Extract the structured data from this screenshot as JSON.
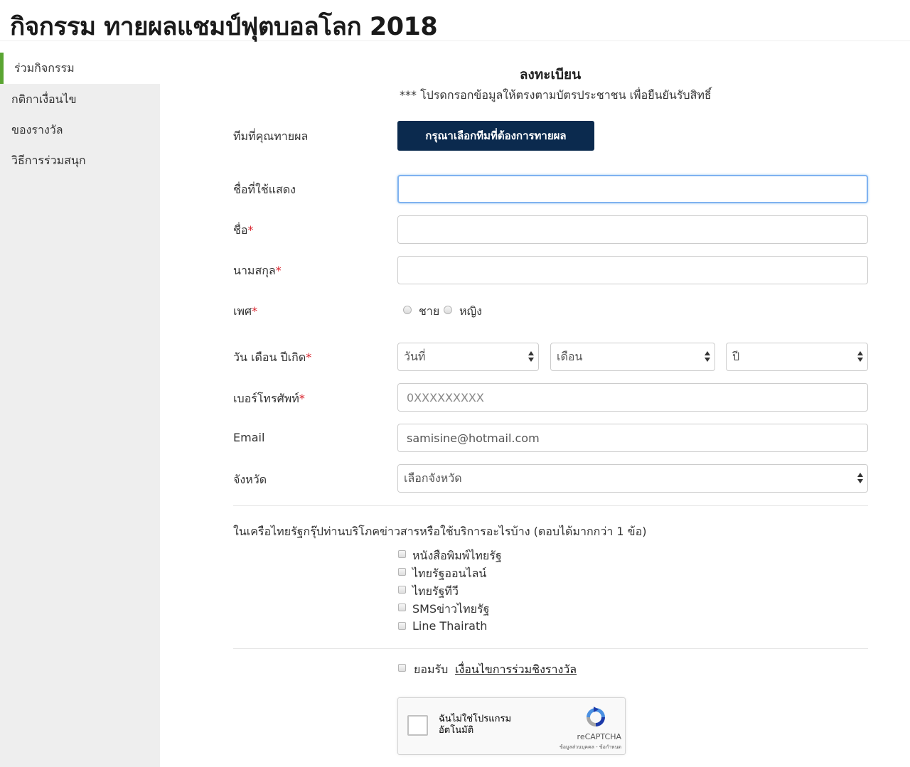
{
  "header": {
    "title": "กิจกรรม ทายผลแชมป์ฟุตบอลโลก 2018"
  },
  "sidebar": {
    "items": [
      {
        "label": "ร่วมกิจกรรม",
        "active": true
      },
      {
        "label": "กติกาเงื่อนไข",
        "active": false
      },
      {
        "label": "ของรางวัล",
        "active": false
      },
      {
        "label": "วิธีการร่วมสนุก",
        "active": false
      }
    ]
  },
  "form": {
    "title": "ลงทะเบียน",
    "note": "*** โปรดกรอกข้อมูลให้ตรงตามบัตรประชาชน เพื่อยืนยันรับสิทธิ์",
    "required_mark": "*",
    "team": {
      "label": "ทีมที่คุณทายผล",
      "button_label": "กรุณาเลือกทีมที่ต้องการทายผล"
    },
    "display_name": {
      "label": "ชื่อที่ใช้แสดง",
      "value": "",
      "placeholder": ""
    },
    "first_name": {
      "label": "ชื่อ",
      "value": "",
      "placeholder": ""
    },
    "last_name": {
      "label": "นามสกุล",
      "value": "",
      "placeholder": ""
    },
    "gender": {
      "label": "เพศ",
      "options": [
        "ชาย",
        "หญิง"
      ]
    },
    "birthdate": {
      "label": "วัน เดือน ปีเกิด",
      "day": "วันที่",
      "month": "เดือน",
      "year": "ปี"
    },
    "phone": {
      "label": "เบอร์โทรศัพท์",
      "value": "",
      "placeholder": "0XXXXXXXXX"
    },
    "email": {
      "label": "Email",
      "value": "samisine@hotmail.com"
    },
    "province": {
      "label": "จังหวัด",
      "selected": "เลือกจังหวัด"
    },
    "media_question": "ในเครือไทยรัฐกรุ๊ปท่านบริโภคข่าวสารหรือใช้บริการอะไรบ้าง (ตอบได้มากกว่า 1 ข้อ)",
    "media_options": [
      "หนังสือพิมพ์ไทยรัฐ",
      "ไทยรัฐออนไลน์",
      "ไทยรัฐทีวี",
      "SMSข่าวไทยรัฐ",
      "Line Thairath"
    ],
    "accept": {
      "label": "ยอมรับ",
      "link": "เงื่อนไขการร่วมชิงรางวัล"
    }
  },
  "recaptcha": {
    "text": "ฉันไม่ใช่โปรแกรมอัตโนมัติ",
    "brand": "reCAPTCHA",
    "links": "ข้อมูลส่วนบุคคล - ข้อกำหนด"
  },
  "colors": {
    "button_bg": "#0b2a4e",
    "active_accent": "#5aa532",
    "required": "#d9232d",
    "focus_border": "#7fb2f0"
  }
}
